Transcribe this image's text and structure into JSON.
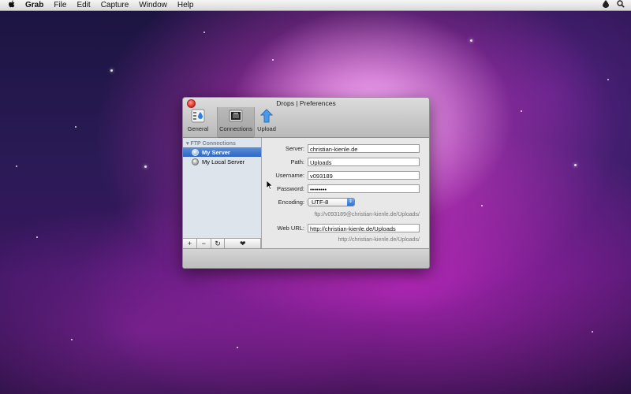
{
  "menubar": {
    "app_name": "Grab",
    "items": [
      "File",
      "Edit",
      "Capture",
      "Window",
      "Help"
    ]
  },
  "window": {
    "title": "Drops | Preferences",
    "toolbar": [
      {
        "label": "General",
        "icon": "general-icon"
      },
      {
        "label": "Connections",
        "icon": "connections-icon",
        "selected": true
      },
      {
        "label": "Upload",
        "icon": "upload-icon"
      }
    ],
    "sidebar": {
      "group": "FTP Connections",
      "items": [
        {
          "label": "My Server",
          "selected": true
        },
        {
          "label": "My Local Server",
          "selected": false
        }
      ],
      "buttons": [
        "+",
        "−",
        "↻",
        "❤"
      ]
    },
    "form": {
      "server_label": "Server:",
      "server_value": "christian-kienle.de",
      "path_label": "Path:",
      "path_value": "Uploads",
      "username_label": "Username:",
      "username_value": "v093189",
      "password_label": "Password:",
      "password_value": "••••••••",
      "encoding_label": "Encoding:",
      "encoding_value": "UTF-8",
      "ftp_hint": "ftp://v093189@christian-kienle.de/Uploads/",
      "weburl_label": "Web URL:",
      "weburl_value": "http://christian-kienle.de/Uploads",
      "weburl_hint": "http://christian-kienle.de/Uploads/"
    }
  },
  "colors": {
    "selection": "#2f66c4",
    "close_button": "#d8241a"
  }
}
